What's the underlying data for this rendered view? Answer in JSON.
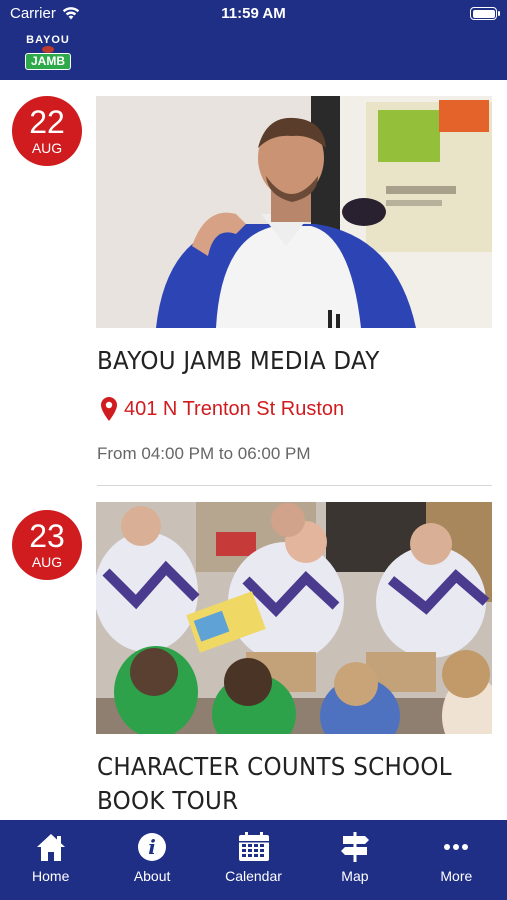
{
  "status_bar": {
    "carrier": "Carrier",
    "time": "11:59 AM"
  },
  "header": {
    "logo_top": "BAYOU",
    "logo_bottom": "JAMB"
  },
  "events": [
    {
      "day": "22",
      "month": "AUG",
      "title": "BAYOU JAMB MEDIA DAY",
      "location": "401 N Trenton St Ruston",
      "time": "From 04:00 PM to 06:00 PM"
    },
    {
      "day": "23",
      "month": "AUG",
      "title": "CHARACTER COUNTS SCHOOL BOOK TOUR"
    }
  ],
  "tabbar": {
    "items": [
      {
        "label": "Home",
        "icon": "home-icon"
      },
      {
        "label": "About",
        "icon": "info-icon"
      },
      {
        "label": "Calendar",
        "icon": "calendar-icon"
      },
      {
        "label": "Map",
        "icon": "signpost-icon"
      },
      {
        "label": "More",
        "icon": "more-icon"
      }
    ]
  },
  "colors": {
    "brand_blue": "#1f2f86",
    "accent_red": "#d01c1f",
    "logo_green": "#2eaa4a"
  }
}
